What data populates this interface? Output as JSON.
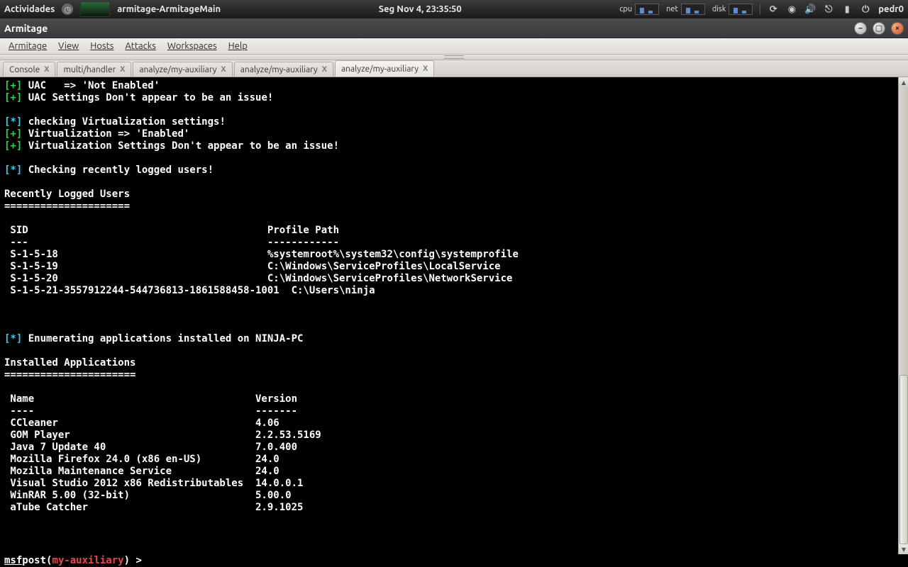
{
  "topbar": {
    "activities": "Actividades",
    "task": "armitage-ArmitageMain",
    "clock": "Seg Nov  4, 23:35:50",
    "meters": {
      "cpu": "cpu",
      "net": "net",
      "disk": "disk"
    },
    "user": "pedr0"
  },
  "window": {
    "title": "Armitage"
  },
  "menu": {
    "armitage": "Armitage",
    "view": "View",
    "hosts": "Hosts",
    "attacks": "Attacks",
    "workspaces": "Workspaces",
    "help": "Help"
  },
  "tabs": [
    {
      "label": "Console"
    },
    {
      "label": "multi/handler"
    },
    {
      "label": "analyze/my-auxiliary"
    },
    {
      "label": "analyze/my-auxiliary"
    },
    {
      "label": "analyze/my-auxiliary"
    }
  ],
  "close_x": "X",
  "console": {
    "lines": [
      {
        "segs": [
          {
            "c": "g",
            "t": "[+]"
          },
          {
            "t": " UAC   => 'Not Enabled'"
          }
        ]
      },
      {
        "segs": [
          {
            "c": "g",
            "t": "[+]"
          },
          {
            "t": " UAC Settings Don't appear to be an issue!"
          }
        ]
      },
      {
        "segs": []
      },
      {
        "segs": [
          {
            "c": "c",
            "t": "[*]"
          },
          {
            "t": " checking Virtualization settings!"
          }
        ]
      },
      {
        "segs": [
          {
            "c": "g",
            "t": "[+]"
          },
          {
            "t": " Virtualization => 'Enabled'"
          }
        ]
      },
      {
        "segs": [
          {
            "c": "g",
            "t": "[+]"
          },
          {
            "t": " Virtualization Settings Don't appear to be an issue!"
          }
        ]
      },
      {
        "segs": []
      },
      {
        "segs": [
          {
            "c": "c",
            "t": "[*]"
          },
          {
            "t": " Checking recently logged users!"
          }
        ]
      },
      {
        "segs": []
      },
      {
        "segs": [
          {
            "t": "Recently Logged Users"
          }
        ]
      },
      {
        "segs": [
          {
            "t": "====================="
          }
        ]
      },
      {
        "segs": []
      },
      {
        "segs": [
          {
            "t": " SID                                        Profile Path"
          }
        ]
      },
      {
        "segs": [
          {
            "t": " ---                                        ------------"
          }
        ]
      },
      {
        "segs": [
          {
            "t": " S-1-5-18                                   %systemroot%\\system32\\config\\systemprofile"
          }
        ]
      },
      {
        "segs": [
          {
            "t": " S-1-5-19                                   C:\\Windows\\ServiceProfiles\\LocalService"
          }
        ]
      },
      {
        "segs": [
          {
            "t": " S-1-5-20                                   C:\\Windows\\ServiceProfiles\\NetworkService"
          }
        ]
      },
      {
        "segs": [
          {
            "t": " S-1-5-21-3557912244-544736813-1861588458-1001  C:\\Users\\ninja"
          }
        ]
      },
      {
        "segs": []
      },
      {
        "segs": []
      },
      {
        "segs": []
      },
      {
        "segs": [
          {
            "c": "c",
            "t": "[*]"
          },
          {
            "t": " Enumerating applications installed on NINJA-PC"
          }
        ]
      },
      {
        "segs": []
      },
      {
        "segs": [
          {
            "t": "Installed Applications"
          }
        ]
      },
      {
        "segs": [
          {
            "t": "======================"
          }
        ]
      },
      {
        "segs": []
      },
      {
        "segs": [
          {
            "t": " Name                                     Version"
          }
        ]
      },
      {
        "segs": [
          {
            "t": " ----                                     -------"
          }
        ]
      },
      {
        "segs": [
          {
            "t": " CCleaner                                 4.06"
          }
        ]
      },
      {
        "segs": [
          {
            "t": " GOM Player                               2.2.53.5169"
          }
        ]
      },
      {
        "segs": [
          {
            "t": " Java 7 Update 40                         7.0.400"
          }
        ]
      },
      {
        "segs": [
          {
            "t": " Mozilla Firefox 24.0 (x86 en-US)         24.0"
          }
        ]
      },
      {
        "segs": [
          {
            "t": " Mozilla Maintenance Service              24.0"
          }
        ]
      },
      {
        "segs": [
          {
            "t": " Visual Studio 2012 x86 Redistributables  14.0.0.1"
          }
        ]
      },
      {
        "segs": [
          {
            "t": " WinRAR 5.00 (32-bit)                     5.00.0"
          }
        ]
      },
      {
        "segs": [
          {
            "t": " aTube Catcher                            2.9.1025"
          }
        ]
      }
    ],
    "prompt": {
      "msf": "msf",
      "post_open": "  post(",
      "module": "my-auxiliary",
      "post_close": ") > "
    }
  }
}
